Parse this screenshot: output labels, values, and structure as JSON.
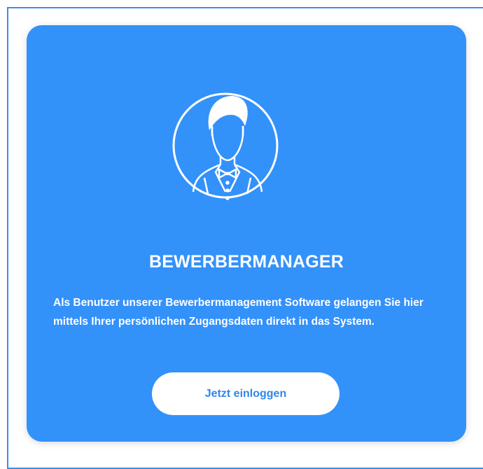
{
  "card": {
    "icon": "person-avatar-icon",
    "title": "BEWERBERMANAGER",
    "description": "Als Benutzer unserer Bewerbermanagement Software gelangen Sie hier mittels Ihrer persönlichen Zugangsdaten direkt in das System.",
    "login_label": "Jetzt einloggen"
  },
  "colors": {
    "card_background": "#3391fa",
    "frame_border": "#3b8fe9",
    "button_text": "#2f86ec",
    "text": "#ffffff"
  }
}
